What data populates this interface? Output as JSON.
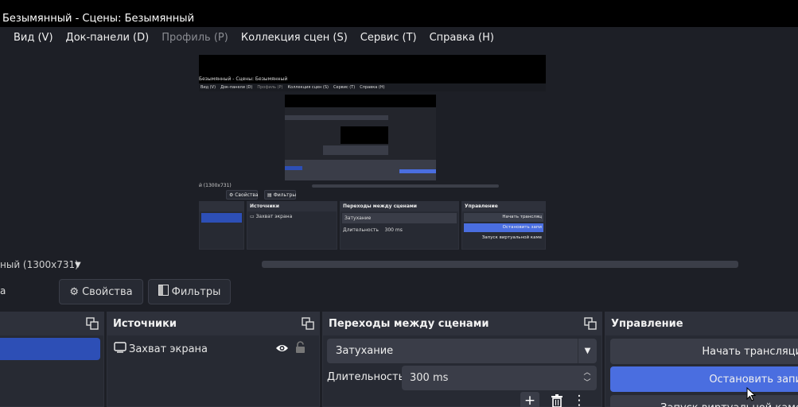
{
  "window": {
    "title": "Безымянный - Сцены: Безымянный"
  },
  "menu": [
    {
      "label": "Вид (V)",
      "enabled": true
    },
    {
      "label": "Док-панели (D)",
      "enabled": true
    },
    {
      "label": "Профиль (P)",
      "enabled": false
    },
    {
      "label": "Коллекция сцен (S)",
      "enabled": true
    },
    {
      "label": "Сервис (T)",
      "enabled": true
    },
    {
      "label": "Справка (H)",
      "enabled": true
    }
  ],
  "preview_thumb": {
    "title": "Безымянный - Сцены: Безымянный",
    "menu": [
      "Вид (V)",
      "Док-панели (D)",
      "Профиль (P)",
      "Коллекция сцен (S)",
      "Сервис (T)",
      "Справка (H)"
    ],
    "scene_label": "й (1300х731)",
    "props": "Свойства",
    "filters": "Фильтры",
    "sources_title": "Источники",
    "source_item": "Захват экрана",
    "transitions_title": "Переходы между сценами",
    "transition": "Затухание",
    "duration_label": "Длительность",
    "duration": "300 ms",
    "controls_title": "Управление",
    "start_stream": "Начать трансляц",
    "stop_record": "Остановить запи",
    "virtual_cam": "Запуск виртуальной каме"
  },
  "scene_bar": {
    "label": "ный (1300х731)"
  },
  "toolbar": {
    "properties_label": "Свойства",
    "filters_label": "Фильтры"
  },
  "docks": {
    "sources": {
      "title": "Источники",
      "items": [
        {
          "label": "Захват экрана",
          "visible": true,
          "locked": false
        }
      ]
    },
    "transitions": {
      "title": "Переходы между сценами",
      "selected": "Затухание",
      "duration_label": "Длительность",
      "duration_value": "300 ms"
    },
    "controls": {
      "title": "Управление",
      "start_stream": "Начать трансляци",
      "stop_record": "Остановить запи",
      "virtual_cam": "Запуск виртуальной каме"
    }
  },
  "colors": {
    "accent": "#4a6ee0",
    "selection": "#2d4fb6",
    "panel": "#272a33",
    "background": "#1d1f26"
  }
}
